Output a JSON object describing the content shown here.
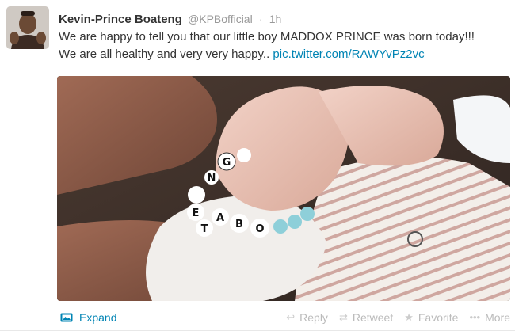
{
  "tweet": {
    "fullname": "Kevin-Prince Boateng",
    "username": "@KPBofficial",
    "separator": "·",
    "time": "1h",
    "text_line1": "We are happy to tell you that our little boy MADDOX PRINCE was born today!!!",
    "text_line2_prefix": "We are all healthy and very very happy.. ",
    "link": "pic.twitter.com/RAWYvPz2vc",
    "bracelet_letters": [
      "B",
      "O",
      "A",
      "T",
      "E",
      "N",
      "G"
    ]
  },
  "actions": {
    "expand": "Expand",
    "reply": "Reply",
    "retweet": "Retweet",
    "favorite": "Favorite",
    "more": "More"
  },
  "icons": {
    "expand": "photo-icon",
    "reply": "reply-icon",
    "retweet": "retweet-icon",
    "favorite": "star-icon",
    "more": "more-icon"
  },
  "colors": {
    "name": "#333333",
    "meta": "#999999",
    "link": "#0084b4",
    "action": "#bbbbbb"
  }
}
